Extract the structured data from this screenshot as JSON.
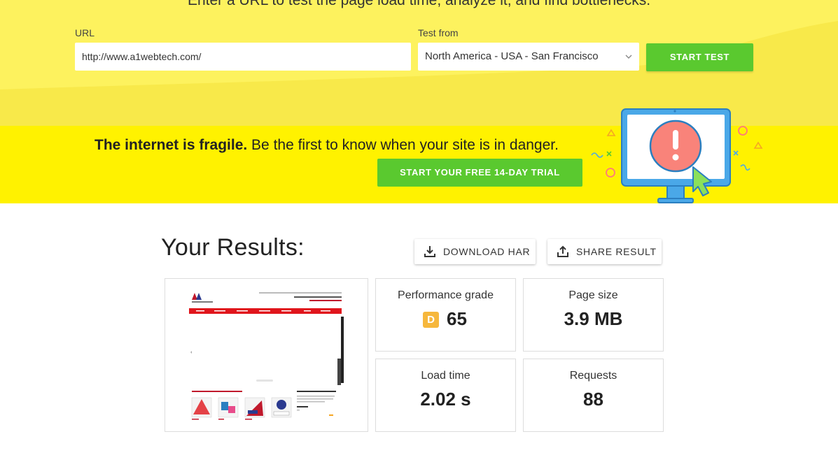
{
  "top": {
    "tagline": "Enter a URL to test the page load time, analyze it, and find bottlenecks.",
    "url_label": "URL",
    "url_value": "http://www.a1webtech.com/",
    "test_from_label": "Test from",
    "test_from_value": "North America - USA - San Francisco",
    "start_label": "START TEST"
  },
  "banner": {
    "headline_bold": "The internet is fragile.",
    "headline_rest": " Be the first to know when your site is in danger.",
    "cta_label": "START YOUR FREE 14-DAY TRIAL"
  },
  "results": {
    "title": "Your Results:",
    "download_har": "DOWNLOAD HAR",
    "share_result": "SHARE RESULT",
    "stats": {
      "performance_label": "Performance grade",
      "grade_letter": "D",
      "grade_score": "65",
      "page_size_label": "Page size",
      "page_size_value": "3.9 MB",
      "load_time_label": "Load time",
      "load_time_value": "2.02 s",
      "requests_label": "Requests",
      "requests_value": "88"
    }
  },
  "colors": {
    "top_bg": "#fdf25e",
    "banner_bg": "#fff200",
    "accent_green": "#5ac92f",
    "grade_orange": "#f6b73c",
    "monitor_blue": "#4aa8e8"
  }
}
